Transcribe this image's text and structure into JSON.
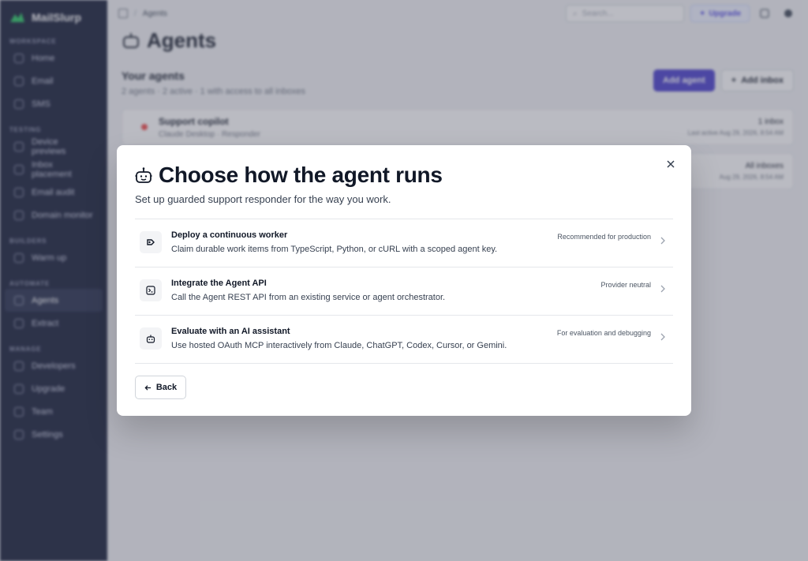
{
  "sidebar": {
    "brand": "MailSlurp",
    "sections": [
      {
        "label": "WORKSPACE",
        "items": [
          "Home",
          "Email",
          "SMS"
        ]
      },
      {
        "label": "TESTING",
        "items": [
          "Device previews",
          "Inbox placement",
          "Email audit",
          "Domain monitor"
        ]
      },
      {
        "label": "BUILDERS",
        "items": [
          "Warm up"
        ]
      },
      {
        "label": "AUTOMATE",
        "items": [
          "Agents",
          "Extract"
        ]
      },
      {
        "label": "MANAGE",
        "items": [
          "Developers",
          "Upgrade",
          "Team",
          "Settings"
        ]
      }
    ],
    "active_item": "Agents"
  },
  "topbar": {
    "breadcrumb": "Agents",
    "search_placeholder": "Search...",
    "upgrade_label": "Upgrade"
  },
  "page": {
    "title": "Agents",
    "your_agents_title": "Your agents",
    "your_agents_sub": "2 agents · 2 active · 1 with access to all inboxes",
    "add_agent_label": "Add agent",
    "add_inbox_label": "Add inbox",
    "agents": [
      {
        "name": "Support copilot",
        "sub": "Claude Desktop · Responder",
        "meta": "1 inbox",
        "meta_small": "Last active Aug 29, 2026, 8:54 AM"
      },
      {
        "name": "",
        "sub": "",
        "meta": "All inboxes",
        "meta_small": "Aug 29, 2026, 8:54 AM"
      }
    ]
  },
  "modal": {
    "title": "Choose how the agent runs",
    "subtitle": "Set up guarded support responder for the way you work.",
    "options": [
      {
        "title": "Deploy a continuous worker",
        "desc": "Claim durable work items from TypeScript, Python, or cURL with a scoped agent key.",
        "tag": "Recommended for production",
        "icon": "worker-icon"
      },
      {
        "title": "Integrate the Agent API",
        "desc": "Call the Agent REST API from an existing service or agent orchestrator.",
        "tag": "Provider neutral",
        "icon": "terminal-icon"
      },
      {
        "title": "Evaluate with an AI assistant",
        "desc": "Use hosted OAuth MCP interactively from Claude, ChatGPT, Codex, Cursor, or Gemini.",
        "tag": "For evaluation and debugging",
        "icon": "robot-icon"
      }
    ],
    "back_label": "Back"
  },
  "colors": {
    "sidebar_bg": "#0d1530",
    "accent": "#4338ca",
    "brand_green": "#22c55e"
  }
}
